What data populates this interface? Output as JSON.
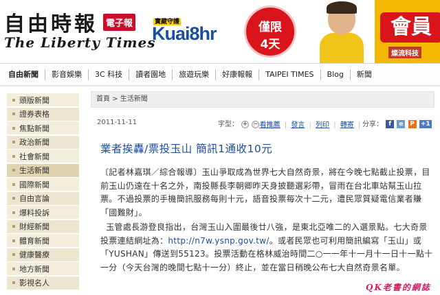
{
  "header": {
    "logo_cn": "自由時報",
    "logo_badge": "電子報",
    "logo_en": "The Liberty Times"
  },
  "ad": {
    "tag": "寶藏守護",
    "brand": "Kuai8hr",
    "circle_line1": "僅限",
    "circle_line2": "4天",
    "right_big": "會員",
    "right_small": "燦流科技"
  },
  "nav": {
    "items": [
      "自由新聞",
      "影音娛樂",
      "3C 科技",
      "讀者園地",
      "旅遊玩樂",
      "好康報報",
      "TAIPEI TIMES",
      "Blog",
      "新聞"
    ]
  },
  "sidebar": {
    "items": [
      "頭版新聞",
      "證券表格",
      "焦點新聞",
      "政治新聞",
      "社會新聞",
      "生活新聞",
      "國際新聞",
      "自由言論",
      "爆料投訴",
      "財經新聞",
      "體育新聞",
      "健康醫療",
      "地方新聞",
      "影視名人"
    ]
  },
  "article": {
    "breadcrumb": "首頁 > 生活新聞",
    "date": "2011-11-11",
    "font_label": "字型：",
    "font_plus": "+",
    "font_minus": "−",
    "actions": [
      "看推薦",
      "發言",
      "列印",
      "轉寄"
    ],
    "share_label": "分享：",
    "share_icons": [
      "f",
      "e",
      "P",
      "+1"
    ],
    "headline": "業者挨轟/票投玉山 簡訊1通收10元",
    "para1": "〔記者林嘉琪／綜合報導〕玉山爭取成為世界七大自然奇景，將在今晚七點截止投票，目前玉山仍遠在十名之外，南投縣長李朝卿昨天身披聽選彩帶，冒雨在台北車站幫玉山拉票。不過投票的手機簡訊服務每則十元，語音投票每次十二元，遭民眾質疑電信業者賺「國難財」。",
    "para2_a": "玉管處長游登良指出，台灣玉山入圍最後廿八強，是東北亞唯二的入選景點。七大奇景投票連結網址為：",
    "para2_link": "http://n7w.ysnp.gov.tw/",
    "para2_b": "。或者民眾也可利用簡訊編寫「玉山」或「YUSHAN」傳送到55123。投票活動在格林威治時間二○一一年十一月十一日十一點十一分（今天台灣的晚間七點十一分）終止，並在當日稍晚公布七大自然奇景名單。"
  },
  "watermark": "QK老書的網誌",
  "colors": {
    "headline": "#1e4e9e",
    "sidebar_bg": "#f3eddc",
    "logo_badge": "#c8102e",
    "ad_brand": "#1a4fa0",
    "ad_circle": "#d9141b",
    "watermark": "#d81b60"
  }
}
